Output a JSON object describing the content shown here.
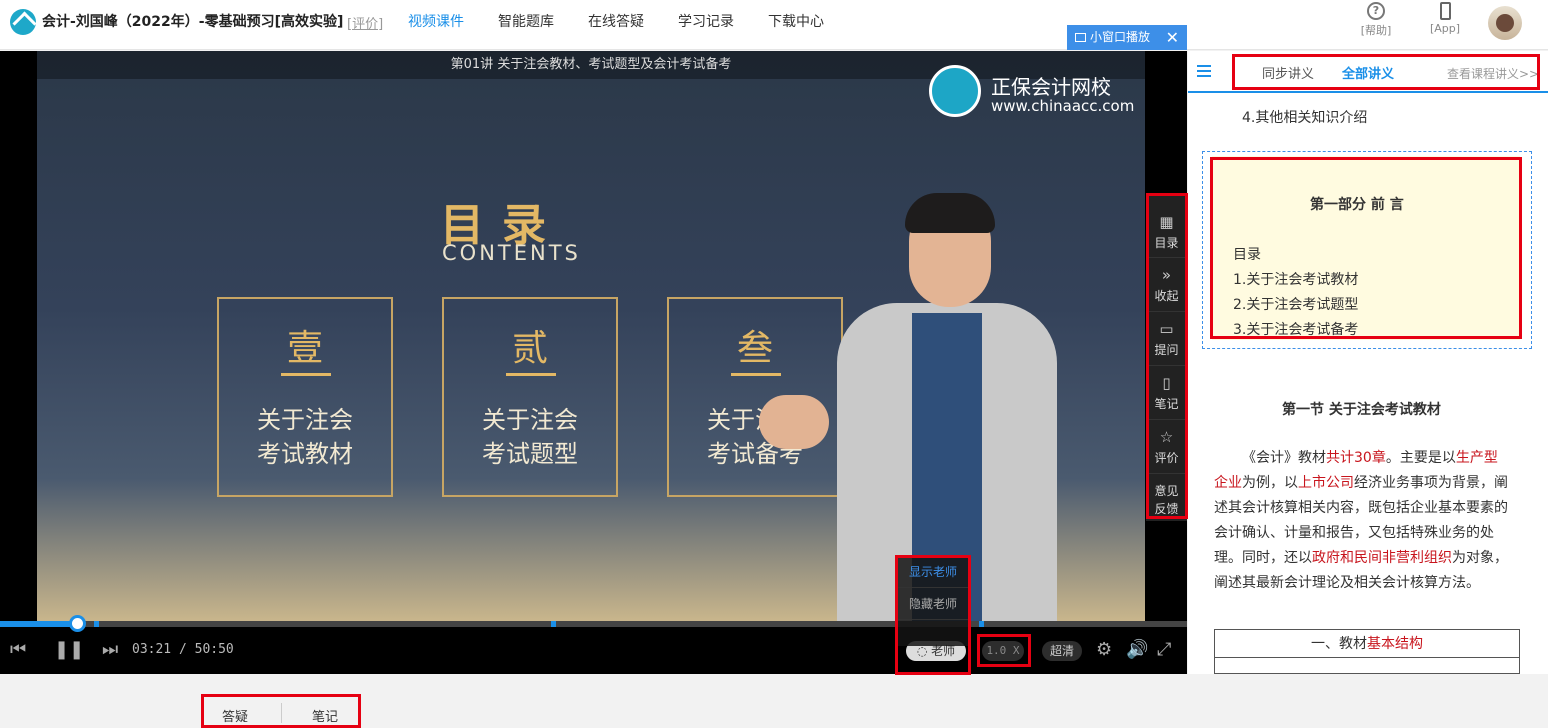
{
  "header": {
    "course_title": "会计-刘国峰（2022年）-零基础预习[高效实验]",
    "rating_link": "[评价]",
    "nav": [
      "视频课件",
      "智能题库",
      "在线答疑",
      "学习记录",
      "下载中心"
    ],
    "help_label": "[帮助]",
    "help_glyph": "?",
    "app_label": "[App]",
    "accent_color": "#1a8fe8"
  },
  "player": {
    "mini_window_label": "小窗口播放",
    "close_glyph": "✕",
    "lecture_title": "第01讲  关于注会教材、考试题型及会计考试备考",
    "brand_name": "正保会计网校",
    "brand_url": "www.chinaacc.com",
    "slide": {
      "heading": "目录",
      "heading_en": "CONTENTS",
      "cards": [
        {
          "num": "壹",
          "line1": "关于注会",
          "line2": "考试教材"
        },
        {
          "num": "贰",
          "line1": "关于注会",
          "line2": "考试题型"
        },
        {
          "num": "叁",
          "line1": "关于注会",
          "line2": "考试备考"
        }
      ]
    },
    "progress_fraction": 0.066,
    "time_current": "03:21",
    "time_separator": "/",
    "time_total": "50:50",
    "teacher_toggle": "老师",
    "speed": "1.0 X",
    "quality": "超清",
    "teacher_menu": [
      "显示老师",
      "隐藏老师"
    ],
    "side_menu": [
      {
        "icon": "grid-icon",
        "glyph": "▦",
        "label": "目录"
      },
      {
        "icon": "collapse-icon",
        "glyph": "»",
        "label": "收起"
      },
      {
        "icon": "question-icon",
        "glyph": "▭",
        "label": "提问"
      },
      {
        "icon": "note-icon",
        "glyph": "▯",
        "label": "笔记"
      },
      {
        "icon": "star-icon",
        "glyph": "☆",
        "label": "评价"
      },
      {
        "icon": "feedback-icon",
        "glyph": "",
        "label": "意见反馈"
      }
    ]
  },
  "notes": {
    "tabs": [
      "同步讲义",
      "全部讲义"
    ],
    "view_all": "查看课程讲义>>",
    "item4": "4.其他相关知识介绍",
    "preface_title": "第一部分  前  言",
    "toc_label": "目录",
    "toc_items": [
      "1.关于注会考试教材",
      "2.关于注会考试题型",
      "3.关于注会考试备考"
    ],
    "section_title": "第一节  关于注会考试教材",
    "paragraph": {
      "p1": "《会计》教材",
      "h1": "共计30章",
      "p2": "。主要是以",
      "h2": "生产型企业",
      "p3": "为例，以",
      "h3": "上市公司",
      "p4": "经济业务事项为背景，阐述其会计核算相关内容，既包括企业基本要素的会计确认、计量和报告，又包括特殊业务的处理。同时，还以",
      "h4": "政府和民间非营利组织",
      "p5": "为对象，阐述其最新会计理论及相关会计核算方法。"
    },
    "table_title_a": "一、教材",
    "table_title_b": "基本结构"
  },
  "bottom_tabs": [
    "答疑",
    "笔记"
  ]
}
